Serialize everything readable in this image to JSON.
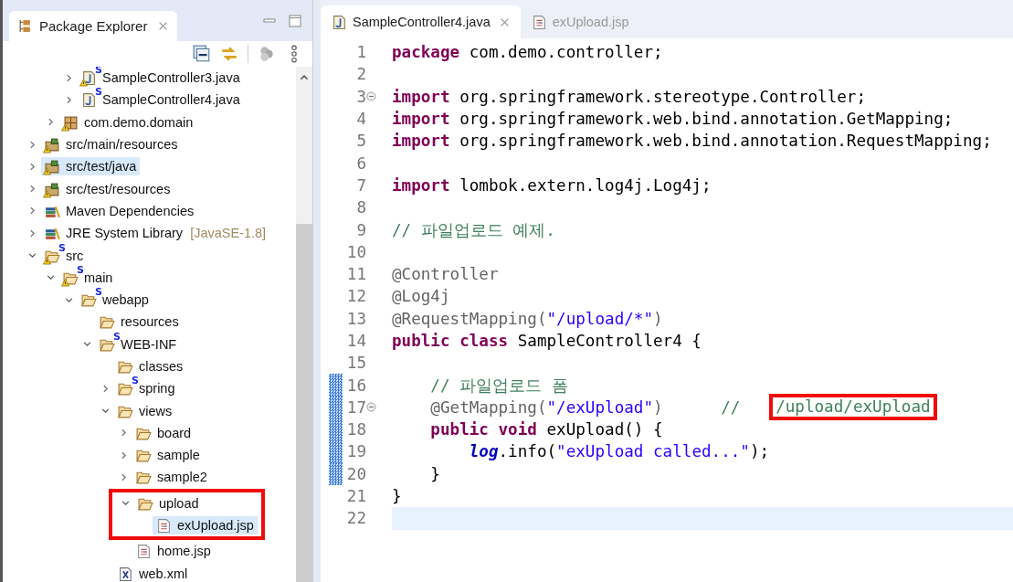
{
  "explorer": {
    "title": "Package Explorer",
    "tree": [
      {
        "children": [
          {
            "children": [
              {
                "label": "SampleController3.java",
                "kind": "java",
                "badge": "S",
                "warning": true,
                "expanded": false,
                "selected": false
              },
              {
                "label": "SampleController4.java",
                "kind": "java",
                "badge": "S",
                "warning": false,
                "expanded": false,
                "selected": false
              }
            ]
          },
          {
            "label": "com.demo.domain",
            "kind": "package",
            "warning": true,
            "expanded": false,
            "selected": false
          }
        ]
      },
      {
        "label": "src/main/resources",
        "kind": "source-folder",
        "warning": true,
        "expanded": false,
        "selected": false
      },
      {
        "label": "src/test/java",
        "kind": "source-folder",
        "warning": true,
        "expanded": false,
        "selected": true
      },
      {
        "label": "src/test/resources",
        "kind": "source-folder",
        "warning": true,
        "expanded": false,
        "selected": false
      },
      {
        "label": "Maven Dependencies",
        "kind": "library",
        "warning": false,
        "expanded": false,
        "selected": false
      },
      {
        "label": "JRE System Library",
        "suffix": "[JavaSE-1.8]",
        "kind": "library",
        "warning": false,
        "expanded": false,
        "selected": false
      },
      {
        "label": "src",
        "kind": "folder",
        "badge": "S",
        "warning": true,
        "expanded": true,
        "selected": false,
        "children": [
          {
            "label": "main",
            "kind": "folder",
            "badge": "S",
            "warning": true,
            "expanded": true,
            "selected": false,
            "children": [
              {
                "label": "webapp",
                "kind": "folder",
                "badge": "S",
                "warning": false,
                "expanded": true,
                "selected": false,
                "children": [
                  {
                    "label": "resources",
                    "kind": "folder",
                    "warning": false,
                    "selected": false
                  },
                  {
                    "label": "WEB-INF",
                    "kind": "folder",
                    "badge": "S",
                    "warning": false,
                    "expanded": true,
                    "selected": false,
                    "children": [
                      {
                        "label": "classes",
                        "kind": "folder",
                        "warning": false,
                        "selected": false
                      },
                      {
                        "label": "spring",
                        "kind": "folder",
                        "badge": "S",
                        "warning": false,
                        "expanded": false,
                        "selected": false
                      },
                      {
                        "label": "views",
                        "kind": "folder",
                        "warning": false,
                        "expanded": true,
                        "selected": false,
                        "children": [
                          {
                            "label": "board",
                            "kind": "folder",
                            "warning": false,
                            "expanded": false,
                            "selected": false
                          },
                          {
                            "label": "sample",
                            "kind": "folder",
                            "warning": false,
                            "expanded": false,
                            "selected": false
                          },
                          {
                            "label": "sample2",
                            "kind": "folder",
                            "warning": false,
                            "expanded": false,
                            "selected": false
                          },
                          {
                            "label": "upload",
                            "kind": "folder",
                            "warning": false,
                            "expanded": true,
                            "selected": false,
                            "highlighted": true,
                            "children": [
                              {
                                "label": "exUpload.jsp",
                                "kind": "jsp",
                                "warning": false,
                                "selected": true
                              }
                            ]
                          },
                          {
                            "label": "home.jsp",
                            "kind": "jsp",
                            "warning": false,
                            "selected": false
                          }
                        ]
                      },
                      {
                        "label": "web.xml",
                        "kind": "xml",
                        "warning": false,
                        "selected": false
                      }
                    ]
                  }
                ]
              }
            ]
          }
        ]
      }
    ]
  },
  "editor": {
    "tabs": [
      {
        "label": "SampleController4.java",
        "kind": "java",
        "selected": true
      },
      {
        "label": "exUpload.jsp",
        "kind": "jsp",
        "selected": false
      }
    ],
    "lines": [
      {
        "number": "1",
        "fold": false,
        "changed": false,
        "current": false,
        "tokens": [
          {
            "kind": "keyword",
            "text": "package"
          },
          {
            "kind": "plain",
            "text": " com.demo.controller;"
          }
        ]
      },
      {
        "number": "2",
        "fold": false,
        "changed": false,
        "current": false
      },
      {
        "number": "3",
        "fold": true,
        "changed": false,
        "current": false,
        "tokens": [
          {
            "kind": "keyword",
            "text": "import"
          },
          {
            "kind": "plain",
            "text": " org.springframework.stereotype.Controller;"
          }
        ]
      },
      {
        "number": "4",
        "fold": false,
        "changed": false,
        "current": false,
        "tokens": [
          {
            "kind": "keyword",
            "text": "import"
          },
          {
            "kind": "plain",
            "text": " org.springframework.web.bind.annotation.GetMapping;"
          }
        ]
      },
      {
        "number": "5",
        "fold": false,
        "changed": false,
        "current": false,
        "tokens": [
          {
            "kind": "keyword",
            "text": "import"
          },
          {
            "kind": "plain",
            "text": " org.springframework.web.bind.annotation.RequestMapping;"
          }
        ]
      },
      {
        "number": "6",
        "fold": false,
        "changed": false,
        "current": false
      },
      {
        "number": "7",
        "fold": false,
        "changed": false,
        "current": false,
        "tokens": [
          {
            "kind": "keyword",
            "text": "import"
          },
          {
            "kind": "plain",
            "text": " lombok.extern.log4j.Log4j;"
          }
        ]
      },
      {
        "number": "8",
        "fold": false,
        "changed": false,
        "current": false
      },
      {
        "number": "9",
        "fold": false,
        "changed": false,
        "current": false,
        "tokens": [
          {
            "kind": "comment",
            "text": "// 파일업로드 예제."
          }
        ]
      },
      {
        "number": "10",
        "fold": false,
        "changed": false,
        "current": false
      },
      {
        "number": "11",
        "fold": false,
        "changed": false,
        "current": false,
        "tokens": [
          {
            "kind": "annotation",
            "text": "@Controller"
          }
        ]
      },
      {
        "number": "12",
        "fold": false,
        "changed": false,
        "current": false,
        "tokens": [
          {
            "kind": "annotation",
            "text": "@Log4j"
          }
        ]
      },
      {
        "number": "13",
        "fold": false,
        "changed": false,
        "current": false,
        "tokens": [
          {
            "kind": "annotation",
            "text": "@RequestMapping("
          },
          {
            "kind": "string",
            "text": "\"/upload/*\""
          },
          {
            "kind": "annotation",
            "text": ")"
          }
        ]
      },
      {
        "number": "14",
        "fold": false,
        "changed": false,
        "current": false,
        "tokens": [
          {
            "kind": "keyword",
            "text": "public class"
          },
          {
            "kind": "plain",
            "text": " SampleController4 {"
          }
        ]
      },
      {
        "number": "15",
        "fold": false,
        "changed": false,
        "current": false
      },
      {
        "number": "16",
        "fold": false,
        "changed": true,
        "current": false,
        "tokens": [
          {
            "kind": "comment",
            "text": "    // 파일업로드 폼"
          }
        ]
      },
      {
        "number": "17",
        "fold": true,
        "changed": true,
        "current": false,
        "tokens": [
          {
            "kind": "annotation",
            "text": "    @GetMapping("
          },
          {
            "kind": "string",
            "text": "\"/exUpload\""
          },
          {
            "kind": "annotation",
            "text": ")"
          },
          {
            "kind": "comment",
            "text": "      //   "
          },
          {
            "kind": "comment",
            "text": "/upload/exUpload",
            "boxed": true
          }
        ]
      },
      {
        "number": "18",
        "fold": false,
        "changed": true,
        "current": false,
        "tokens": [
          {
            "kind": "keyword",
            "text": "    public void"
          },
          {
            "kind": "plain",
            "text": " exUpload() {"
          }
        ]
      },
      {
        "number": "19",
        "fold": false,
        "changed": true,
        "current": false,
        "tokens": [
          {
            "kind": "field",
            "text": "        log"
          },
          {
            "kind": "plain",
            "text": ".info("
          },
          {
            "kind": "string",
            "text": "\"exUpload called...\""
          },
          {
            "kind": "plain",
            "text": ");"
          }
        ]
      },
      {
        "number": "20",
        "fold": false,
        "changed": true,
        "current": false,
        "tokens": [
          {
            "kind": "plain",
            "text": "    }"
          }
        ]
      },
      {
        "number": "21",
        "fold": false,
        "changed": false,
        "current": false,
        "tokens": [
          {
            "kind": "plain",
            "text": "}"
          }
        ]
      },
      {
        "number": "22",
        "fold": false,
        "changed": false,
        "current": true
      }
    ]
  }
}
